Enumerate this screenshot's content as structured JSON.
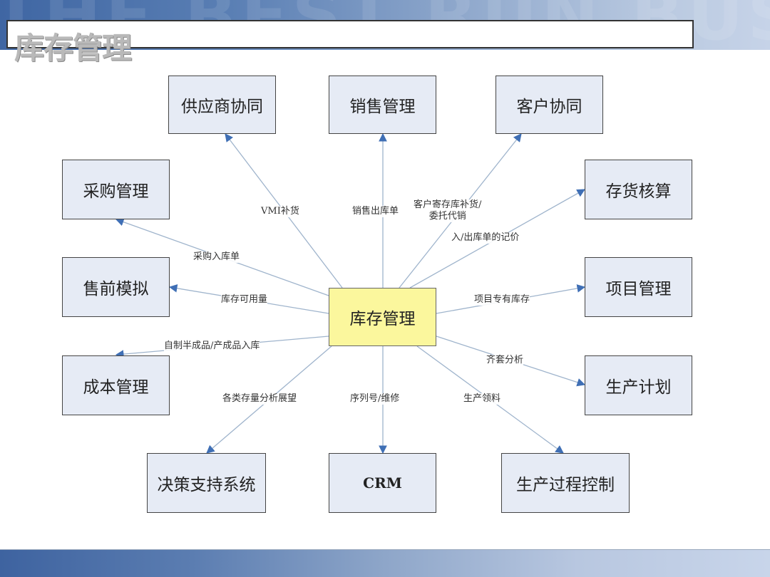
{
  "header": {
    "watermark": "THE BEST RUN BUSINESS",
    "title": "库存管理"
  },
  "theme": {
    "node_fill": "#e6ebf5",
    "center_fill": "#fbf79d",
    "edge_color": "#9fb4cc",
    "arrow_color": "#3f6fb5"
  },
  "diagram": {
    "center": {
      "id": "inventory",
      "label": "库存管理"
    },
    "nodes": [
      {
        "id": "supplier",
        "label": "供应商协同"
      },
      {
        "id": "sales",
        "label": "销售管理"
      },
      {
        "id": "customer",
        "label": "客户协同"
      },
      {
        "id": "purchase",
        "label": "采购管理"
      },
      {
        "id": "costing",
        "label": "存货核算"
      },
      {
        "id": "presales",
        "label": "售前模拟"
      },
      {
        "id": "project",
        "label": "项目管理"
      },
      {
        "id": "cost",
        "label": "成本管理"
      },
      {
        "id": "plan",
        "label": "生产计划"
      },
      {
        "id": "dss",
        "label": "决策支持系统"
      },
      {
        "id": "crm",
        "label": "CRM"
      },
      {
        "id": "production",
        "label": "生产过程控制"
      }
    ],
    "edges": [
      {
        "to": "supplier",
        "label": "VMI补货"
      },
      {
        "to": "sales",
        "label": "销售出库单"
      },
      {
        "to": "customer",
        "label": "客户寄存库补货/\n委托代销"
      },
      {
        "to": "costing",
        "label": "入/出库单的记价"
      },
      {
        "to": "purchase",
        "label": "采购入库单"
      },
      {
        "to": "presales",
        "label": "库存可用量"
      },
      {
        "to": "project",
        "label": "项目专有库存"
      },
      {
        "to": "cost",
        "label": "自制半成品/产成品入库"
      },
      {
        "to": "plan",
        "label": "齐套分析"
      },
      {
        "to": "dss",
        "label": "各类存量分析展望"
      },
      {
        "to": "crm",
        "label": "序列号/维修"
      },
      {
        "to": "production",
        "label": "生产领料"
      }
    ]
  }
}
